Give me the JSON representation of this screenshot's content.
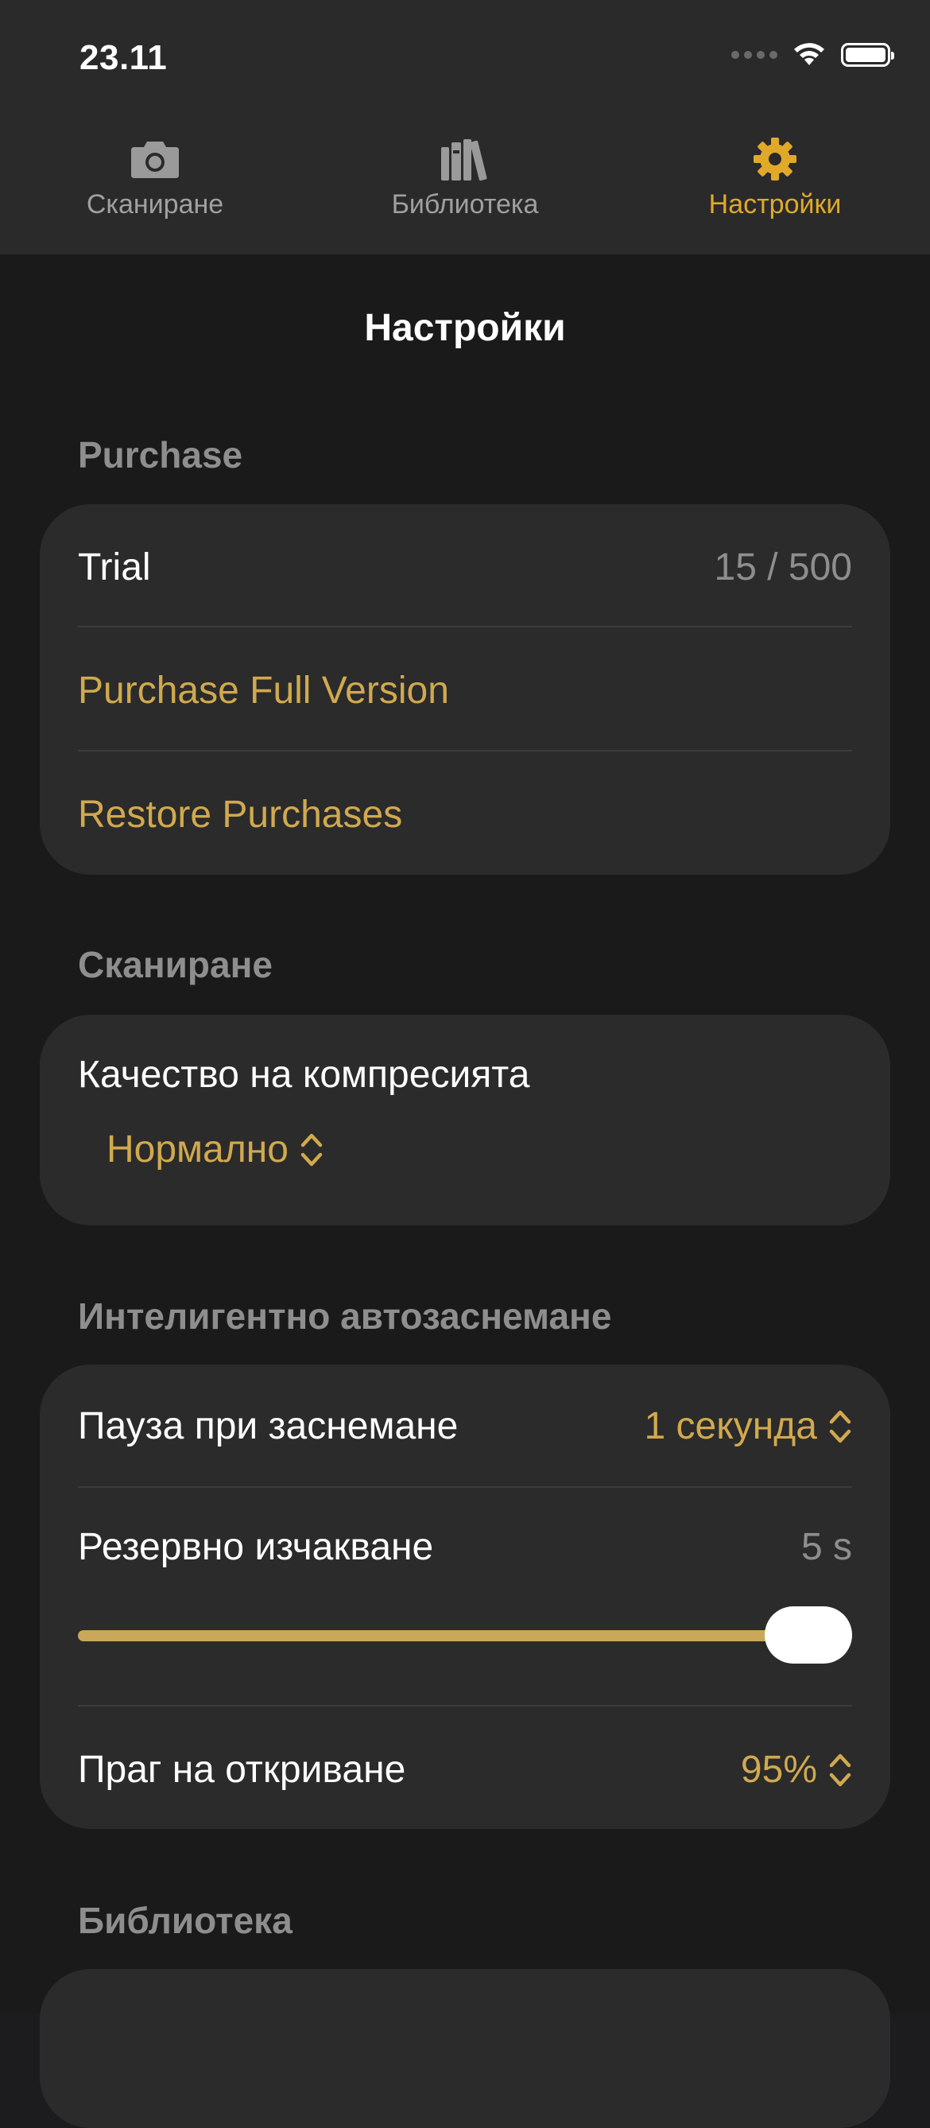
{
  "status_bar": {
    "time": "23.11"
  },
  "tabs": [
    {
      "label": "Сканиране",
      "icon": "camera-icon",
      "active": false
    },
    {
      "label": "Библиотека",
      "icon": "books-icon",
      "active": false
    },
    {
      "label": "Настройки",
      "icon": "gear-icon",
      "active": true
    }
  ],
  "page": {
    "title": "Настройки"
  },
  "purchase": {
    "header": "Purchase",
    "trial_label": "Trial",
    "trial_value": "15 / 500",
    "purchase_full": "Purchase Full Version",
    "restore": "Restore Purchases"
  },
  "scanning": {
    "header": "Сканиране",
    "compression_label": "Качество на компресията",
    "compression_value": "Нормално"
  },
  "smart_capture": {
    "header": "Интелигентно автозаснемане",
    "pause_label": "Пауза при заснемане",
    "pause_value": "1 секунда",
    "fallback_label": "Резервно изчакване",
    "fallback_value": "5 s",
    "fallback_slider_fraction": 1.0,
    "threshold_label": "Праг на откриване",
    "threshold_value": "95%"
  },
  "library": {
    "header": "Библиотека"
  },
  "colors": {
    "accent": "#d1a94e",
    "tab_active": "#e0a92a",
    "background": "#1a1a1a",
    "card": "#2b2b2b"
  }
}
